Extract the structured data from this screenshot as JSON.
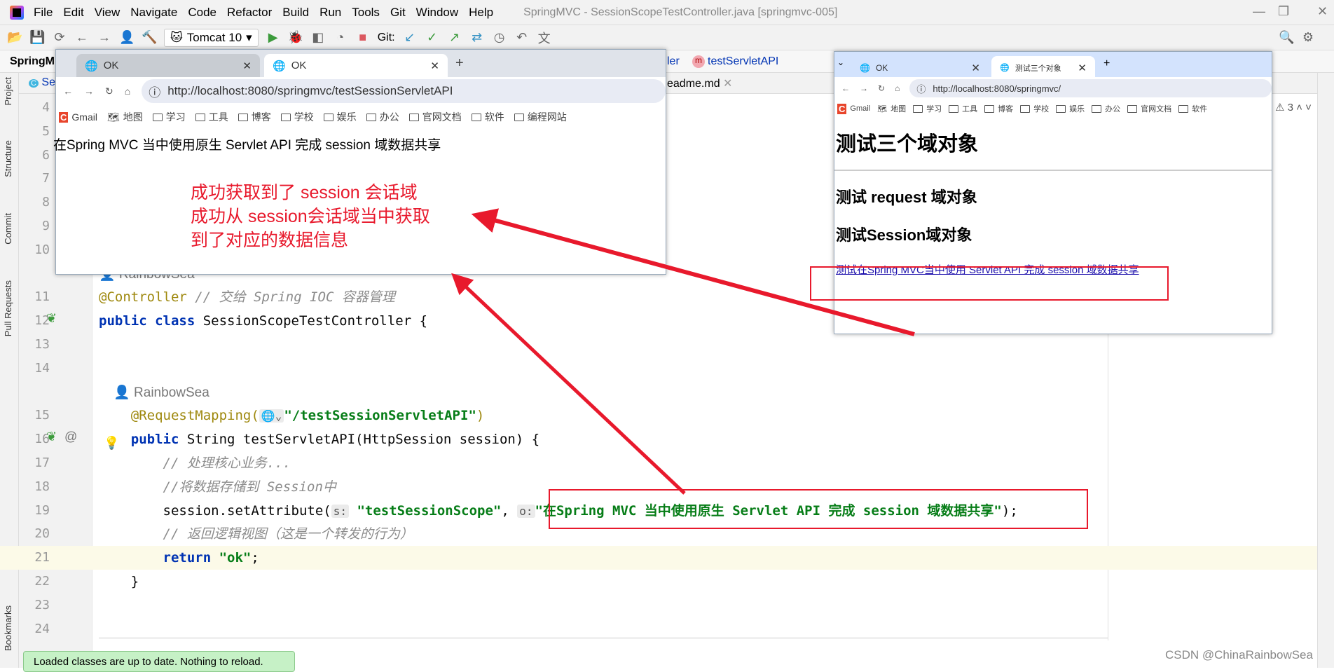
{
  "menubar": {
    "items": [
      "File",
      "Edit",
      "View",
      "Navigate",
      "Code",
      "Refactor",
      "Build",
      "Run",
      "Tools",
      "Git",
      "Window",
      "Help"
    ],
    "window_title": "SpringMVC - SessionScopeTestController.java [springmvc-005]"
  },
  "toolbar": {
    "run_config": "Tomcat 10",
    "git_label": "Git:"
  },
  "navbar": {
    "project": "SpringM",
    "crumb_class": "ler",
    "crumb_method": "testServletAPI"
  },
  "editor_tabs": {
    "first": "Se",
    "readme": "eadme.md"
  },
  "tool_windows": {
    "project": "Project",
    "structure": "Structure",
    "commit": "Commit",
    "pull_requests": "Pull Requests",
    "bookmarks": "Bookmarks"
  },
  "code_lines": [
    {
      "n": "4",
      "tokens": []
    },
    {
      "n": "5",
      "tokens": []
    },
    {
      "n": "6",
      "tokens": []
    },
    {
      "n": "7",
      "tokens": []
    },
    {
      "n": "8",
      "tokens": []
    },
    {
      "n": "9",
      "tokens": []
    },
    {
      "n": "10",
      "tokens": []
    },
    {
      "n": "",
      "tokens": [
        {
          "k": "author",
          "t": "👤 RainbowSea"
        }
      ]
    },
    {
      "n": "11",
      "tokens": [
        {
          "k": "annotation",
          "t": "@Controller"
        },
        {
          "k": "comment",
          "t": " // 交给 Spring IOC 容器管理"
        }
      ]
    },
    {
      "n": "12",
      "tokens": [
        {
          "k": "keyword",
          "t": "public class "
        },
        {
          "k": "plain",
          "t": "SessionScopeTestController {"
        }
      ]
    },
    {
      "n": "13",
      "tokens": []
    },
    {
      "n": "14",
      "tokens": []
    },
    {
      "n": "",
      "tokens": [
        {
          "k": "author",
          "t": "    👤 RainbowSea"
        }
      ]
    },
    {
      "n": "15",
      "tokens": [
        {
          "k": "annotation",
          "t": "    @RequestMapping("
        },
        {
          "k": "hint",
          "t": "🌐⌄"
        },
        {
          "k": "string",
          "t": "\"/testSessionServletAPI\""
        },
        {
          "k": "annotation",
          "t": ")"
        }
      ]
    },
    {
      "n": "16",
      "tokens": [
        {
          "k": "keyword",
          "t": "    public "
        },
        {
          "k": "plain",
          "t": "String testServletAPI(HttpSession session) {"
        }
      ]
    },
    {
      "n": "17",
      "tokens": [
        {
          "k": "comment",
          "t": "        // 处理核心业务..."
        }
      ]
    },
    {
      "n": "18",
      "tokens": [
        {
          "k": "comment",
          "t": "        //将数据存储到 Session中"
        }
      ]
    },
    {
      "n": "19",
      "tokens": [
        {
          "k": "plain",
          "t": "        session.setAttribute("
        },
        {
          "k": "hint",
          "t": "s:"
        },
        {
          "k": "string",
          "t": " \"testSessionScope\""
        },
        {
          "k": "plain",
          "t": ", "
        },
        {
          "k": "hint",
          "t": "o:"
        },
        {
          "k": "string",
          "t": "\"在Spring MVC 当中使用原生 Servlet API 完成 session 域数据共享\""
        },
        {
          "k": "plain",
          "t": ");"
        }
      ]
    },
    {
      "n": "20",
      "tokens": [
        {
          "k": "comment",
          "t": "        // 返回逻辑视图（这是一个转发的行为）"
        }
      ]
    },
    {
      "n": "21",
      "tokens": [
        {
          "k": "keyword",
          "t": "        return "
        },
        {
          "k": "string",
          "t": "\"ok\""
        },
        {
          "k": "plain",
          "t": ";"
        }
      ]
    },
    {
      "n": "22",
      "tokens": [
        {
          "k": "plain",
          "t": "    }"
        }
      ]
    },
    {
      "n": "23",
      "tokens": []
    },
    {
      "n": "24",
      "tokens": []
    }
  ],
  "browser_left": {
    "tabs": [
      {
        "title": "OK"
      },
      {
        "title": "OK"
      }
    ],
    "url": "http://localhost:8080/springmvc/testSessionServletAPI",
    "bookmarks": [
      "Gmail",
      "地图",
      "学习",
      "工具",
      "博客",
      "学校",
      "娱乐",
      "办公",
      "官网文档",
      "软件",
      "编程网站"
    ],
    "body_text": "在Spring MVC 当中使用原生 Servlet API 完成 session 域数据共享"
  },
  "browser_right": {
    "tabs": [
      {
        "title": "OK"
      },
      {
        "title": "测试三个对象"
      }
    ],
    "url": "http://localhost:8080/springmvc/",
    "bookmarks": [
      "Gmail",
      "地图",
      "学习",
      "工具",
      "博客",
      "学校",
      "娱乐",
      "办公",
      "官网文档",
      "软件"
    ],
    "h1": "测试三个域对象",
    "h2_request": "测试 request 域对象",
    "h2_session": "测试Session域对象",
    "link": "测试在Spring MVC当中使用 Servlet API 完成 session 域数据共享"
  },
  "annotation": {
    "lines": [
      "成功获取到了 session 会话域",
      "成功从 session会话域当中获取",
      "到了对应的数据信息"
    ],
    "color": "#e8192c"
  },
  "inspections": {
    "warnings": "3"
  },
  "toast": "Loaded classes are up to date. Nothing to reload.",
  "watermark": "CSDN @ChinaRainbowSea"
}
